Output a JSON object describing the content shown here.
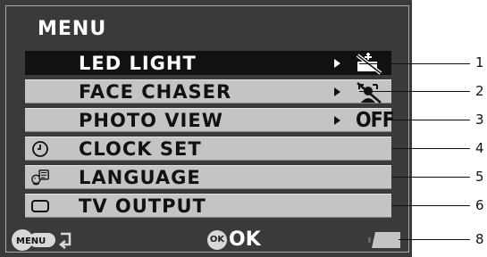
{
  "menu": {
    "title": "MENU",
    "items": [
      {
        "label": "LED LIGHT",
        "icon": "",
        "value_icon": "led-light-off-icon",
        "selected": true
      },
      {
        "label": "FACE CHASER",
        "icon": "",
        "value_icon": "face-chaser-off-icon",
        "selected": false
      },
      {
        "label": "PHOTO VIEW",
        "icon": "",
        "value_text": "OFF",
        "selected": false
      },
      {
        "label": "CLOCK SET",
        "icon": "clock-icon",
        "selected": false
      },
      {
        "label": "LANGUAGE",
        "icon": "language-icon",
        "selected": false
      },
      {
        "label": "TV OUTPUT",
        "icon": "tv-icon",
        "selected": false
      }
    ]
  },
  "bottom_bar": {
    "menu_button_label": "MENU",
    "ok_circle_label": "OK",
    "ok_label": "OK",
    "battery_icon": "battery-icon"
  },
  "callouts": [
    "1",
    "2",
    "3",
    "4",
    "5",
    "6",
    "8"
  ],
  "colors": {
    "screen_bg": "#3a3a3a",
    "row_bg": "#c4c4c4",
    "selected_row_bg": "#111111",
    "text": "#111111",
    "selected_text": "#ffffff"
  }
}
